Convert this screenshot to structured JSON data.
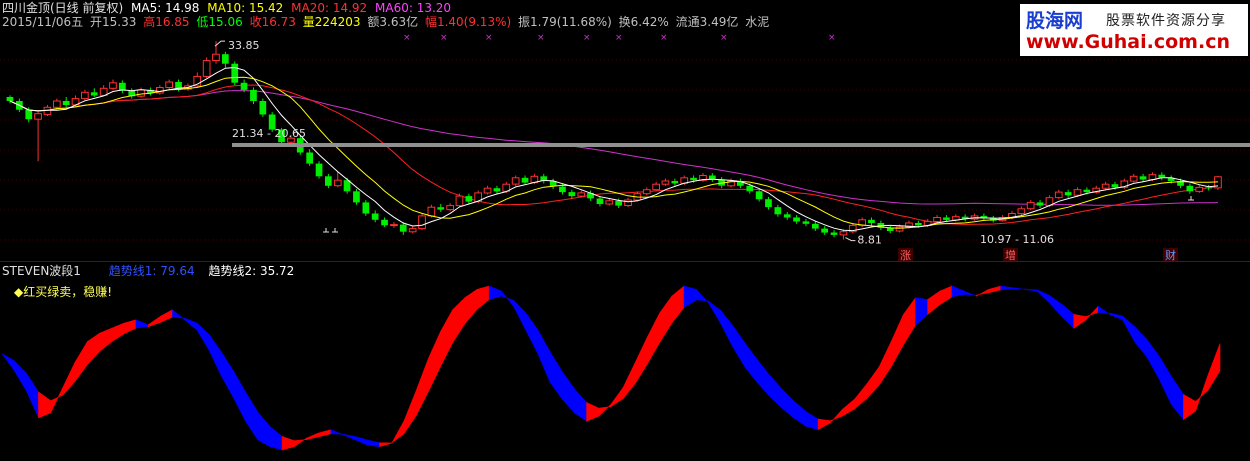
{
  "header": {
    "title": "四川金顶(日线 前复权)",
    "ma5": "MA5: 14.98",
    "ma10": "MA10: 15.42",
    "ma20": "MA20: 14.92",
    "ma60": "MA60: 13.20",
    "date": "2015/11/06五",
    "open": "开15.33",
    "high": "高16.85",
    "low": "低15.06",
    "close": "收16.73",
    "volume": "量224203",
    "amount": "额3.63亿",
    "change": "幅1.40(9.13%)",
    "amplitude": "振1.79(11.68%)",
    "turnover": "换6.42%",
    "float": "流通3.49亿",
    "industry": "水泥"
  },
  "watermark": {
    "brand": "股海网",
    "slogan": "股票软件资源分享",
    "url": "www.Guhai.com.cn"
  },
  "indicator": {
    "name": "STEVEN波段1",
    "line1": "趋势线1: 79.64",
    "line2": "趋势线2: 35.72",
    "note": "◆红买绿卖，稳赚!"
  },
  "colors": {
    "up": "#ff3030",
    "down": "#00ee00",
    "ma5": "#ffffff",
    "ma10": "#ffff00",
    "ma20": "#ff2020",
    "ma60": "#cc33cc",
    "band_up": "#ff0000",
    "band_down": "#0000ff"
  },
  "chart_data": [
    {
      "type": "candlestick",
      "annotations": {
        "high": "33.85",
        "range1": "21.34 - 20.65",
        "low": "8.81",
        "range2": "10.97 - 11.06",
        "events": [
          "涨",
          "增",
          "财"
        ]
      },
      "candles": [
        [
          26.8,
          26.3,
          27.0,
          26.0
        ],
        [
          26.3,
          25.2,
          26.6,
          24.9
        ],
        [
          25.2,
          24.0,
          25.5,
          23.6
        ],
        [
          24.0,
          24.7,
          25.0,
          18.7
        ],
        [
          24.6,
          25.5,
          25.8,
          24.4
        ],
        [
          25.5,
          26.3,
          26.6,
          25.2
        ],
        [
          26.3,
          25.8,
          26.8,
          25.5
        ],
        [
          25.8,
          26.6,
          27.0,
          25.6
        ],
        [
          26.6,
          27.4,
          27.7,
          26.4
        ],
        [
          27.4,
          27.0,
          27.9,
          26.8
        ],
        [
          27.0,
          27.9,
          28.3,
          26.9
        ],
        [
          27.9,
          28.6,
          29.0,
          27.7
        ],
        [
          28.6,
          27.6,
          28.9,
          27.3
        ],
        [
          27.6,
          26.9,
          27.9,
          26.6
        ],
        [
          26.9,
          27.7,
          28.0,
          26.7
        ],
        [
          27.7,
          27.3,
          28.0,
          27.0
        ],
        [
          27.3,
          28.0,
          28.3,
          27.1
        ],
        [
          28.0,
          28.7,
          29.0,
          27.8
        ],
        [
          28.7,
          27.8,
          29.0,
          27.5
        ],
        [
          27.8,
          28.2,
          28.5,
          27.6
        ],
        [
          28.2,
          29.4,
          29.9,
          28.0
        ],
        [
          29.4,
          31.4,
          31.8,
          29.2
        ],
        [
          31.4,
          32.2,
          33.85,
          31.0
        ],
        [
          32.2,
          31.0,
          32.5,
          30.5
        ],
        [
          31.0,
          28.6,
          31.3,
          28.3
        ],
        [
          28.6,
          27.7,
          29.0,
          27.4
        ],
        [
          27.7,
          26.3,
          28.0,
          25.9
        ],
        [
          26.3,
          24.6,
          26.6,
          24.3
        ],
        [
          24.6,
          22.7,
          24.9,
          22.4
        ],
        [
          22.7,
          21.1,
          22.9,
          20.7
        ],
        [
          21.1,
          21.6,
          22.0,
          20.9
        ],
        [
          21.6,
          19.8,
          21.9,
          19.5
        ],
        [
          19.8,
          18.4,
          20.2,
          18.1
        ],
        [
          18.4,
          16.8,
          18.7,
          16.5
        ],
        [
          16.8,
          15.6,
          17.1,
          15.3
        ],
        [
          15.6,
          16.3,
          17.4,
          15.4
        ],
        [
          16.3,
          14.9,
          16.6,
          14.6
        ],
        [
          14.9,
          13.5,
          15.2,
          13.2
        ],
        [
          13.5,
          12.1,
          13.8,
          11.8
        ],
        [
          12.1,
          11.3,
          12.5,
          11.0
        ],
        [
          11.3,
          10.6,
          11.6,
          10.4
        ],
        [
          10.6,
          10.7,
          11.0,
          10.3
        ],
        [
          10.7,
          9.8,
          11.0,
          9.4
        ],
        [
          9.8,
          10.2,
          10.6,
          9.6
        ],
        [
          10.2,
          11.8,
          12.1,
          10.0
        ],
        [
          11.8,
          12.9,
          13.2,
          11.6
        ],
        [
          12.9,
          12.6,
          13.3,
          12.3
        ],
        [
          12.6,
          13.1,
          13.4,
          12.4
        ],
        [
          13.1,
          14.3,
          14.6,
          12.9
        ],
        [
          14.3,
          13.6,
          14.6,
          13.3
        ],
        [
          13.6,
          14.7,
          15.0,
          13.4
        ],
        [
          14.7,
          15.3,
          15.6,
          14.5
        ],
        [
          15.3,
          14.9,
          15.6,
          14.6
        ],
        [
          14.9,
          15.8,
          16.1,
          14.7
        ],
        [
          15.8,
          16.6,
          16.9,
          15.6
        ],
        [
          16.6,
          16.0,
          16.9,
          15.7
        ],
        [
          16.0,
          16.8,
          17.1,
          15.8
        ],
        [
          16.8,
          16.2,
          17.1,
          15.9
        ],
        [
          16.2,
          15.5,
          16.5,
          15.2
        ],
        [
          15.5,
          14.8,
          15.8,
          14.5
        ],
        [
          14.8,
          14.3,
          15.1,
          14.0
        ],
        [
          14.3,
          14.7,
          15.0,
          14.1
        ],
        [
          14.7,
          14.0,
          15.0,
          13.7
        ],
        [
          14.0,
          13.3,
          14.3,
          13.0
        ],
        [
          13.3,
          13.7,
          14.0,
          13.1
        ],
        [
          13.7,
          13.1,
          14.0,
          12.8
        ],
        [
          13.1,
          13.8,
          14.1,
          12.9
        ],
        [
          13.8,
          14.6,
          14.9,
          13.6
        ],
        [
          14.6,
          15.1,
          15.4,
          14.4
        ],
        [
          15.1,
          15.8,
          16.1,
          14.9
        ],
        [
          15.8,
          16.2,
          16.5,
          15.6
        ],
        [
          16.2,
          15.9,
          16.5,
          15.6
        ],
        [
          15.9,
          16.6,
          16.9,
          15.7
        ],
        [
          16.6,
          16.3,
          16.9,
          16.0
        ],
        [
          16.3,
          16.9,
          17.2,
          16.1
        ],
        [
          16.9,
          16.4,
          17.2,
          16.1
        ],
        [
          16.4,
          15.6,
          16.7,
          15.3
        ],
        [
          15.6,
          16.2,
          16.5,
          15.4
        ],
        [
          16.2,
          15.6,
          16.5,
          15.3
        ],
        [
          15.6,
          14.9,
          15.9,
          14.6
        ],
        [
          14.9,
          13.9,
          15.2,
          13.6
        ],
        [
          13.9,
          12.9,
          14.2,
          12.6
        ],
        [
          12.9,
          12.0,
          13.2,
          11.7
        ],
        [
          12.0,
          11.6,
          12.3,
          11.3
        ],
        [
          11.6,
          11.1,
          11.9,
          10.8
        ],
        [
          11.1,
          10.8,
          11.4,
          10.5
        ],
        [
          10.8,
          10.2,
          11.1,
          9.9
        ],
        [
          10.2,
          9.7,
          10.5,
          9.4
        ],
        [
          9.7,
          9.4,
          10.0,
          9.1
        ],
        [
          9.4,
          9.8,
          10.1,
          8.81
        ],
        [
          9.8,
          10.6,
          10.9,
          9.6
        ],
        [
          10.6,
          11.3,
          11.6,
          10.4
        ],
        [
          11.3,
          10.9,
          11.6,
          10.6
        ],
        [
          10.9,
          10.3,
          11.2,
          10.0
        ],
        [
          10.3,
          9.9,
          10.6,
          9.6
        ],
        [
          9.9,
          10.4,
          10.7,
          9.7
        ],
        [
          10.4,
          10.9,
          11.2,
          10.2
        ],
        [
          10.9,
          10.6,
          11.2,
          10.3
        ],
        [
          10.6,
          11.1,
          11.4,
          10.4
        ],
        [
          11.1,
          11.6,
          11.9,
          10.9
        ],
        [
          11.6,
          11.3,
          11.9,
          11.0
        ],
        [
          11.3,
          11.7,
          12.0,
          11.1
        ],
        [
          11.7,
          11.4,
          12.0,
          11.1
        ],
        [
          11.4,
          11.8,
          12.1,
          11.2
        ],
        [
          11.8,
          11.5,
          12.1,
          11.2
        ],
        [
          11.5,
          11.2,
          11.8,
          10.97
        ],
        [
          11.2,
          11.6,
          11.9,
          11.06
        ],
        [
          11.6,
          12.1,
          12.4,
          11.4
        ],
        [
          12.1,
          12.7,
          13.0,
          11.9
        ],
        [
          12.7,
          13.5,
          13.8,
          12.5
        ],
        [
          13.5,
          13.1,
          13.8,
          12.8
        ],
        [
          13.1,
          14.1,
          14.4,
          12.9
        ],
        [
          14.1,
          14.8,
          15.1,
          13.9
        ],
        [
          14.8,
          14.4,
          15.1,
          14.1
        ],
        [
          14.4,
          15.1,
          15.4,
          14.2
        ],
        [
          15.1,
          14.8,
          15.4,
          14.5
        ],
        [
          14.8,
          15.3,
          15.6,
          14.6
        ],
        [
          15.3,
          15.8,
          16.1,
          15.1
        ],
        [
          15.8,
          15.4,
          16.1,
          15.1
        ],
        [
          15.4,
          16.2,
          16.5,
          15.2
        ],
        [
          16.2,
          16.8,
          17.1,
          16.0
        ],
        [
          16.8,
          16.4,
          17.1,
          16.1
        ],
        [
          16.4,
          17.0,
          17.3,
          16.2
        ],
        [
          17.0,
          16.6,
          17.3,
          16.3
        ],
        [
          16.6,
          16.2,
          16.9,
          15.9
        ],
        [
          16.2,
          15.6,
          16.5,
          15.3
        ],
        [
          15.6,
          14.9,
          15.9,
          14.6
        ],
        [
          14.9,
          15.4,
          15.7,
          14.7
        ],
        [
          15.4,
          15.3,
          15.7,
          15.0
        ],
        [
          15.33,
          16.73,
          16.85,
          15.06
        ]
      ]
    },
    {
      "type": "area",
      "ylim": [
        0,
        100
      ],
      "values": [
        60,
        50,
        38,
        22,
        25,
        40,
        55,
        67,
        72,
        75,
        78,
        80,
        77,
        82,
        86,
        80,
        74,
        62,
        47,
        34,
        20,
        9,
        5,
        3,
        5,
        10,
        13,
        15,
        12,
        9,
        6,
        5,
        7,
        20,
        38,
        57,
        73,
        86,
        93,
        98,
        100,
        97,
        88,
        74,
        60,
        43,
        33,
        25,
        20,
        23,
        30,
        40,
        55,
        70,
        84,
        94,
        100,
        98,
        90,
        78,
        64,
        52,
        43,
        35,
        28,
        22,
        17,
        15,
        19,
        27,
        33,
        42,
        52,
        67,
        83,
        93,
        92,
        97,
        100,
        97,
        94,
        98,
        100,
        99,
        98,
        97,
        90,
        82,
        75,
        80,
        88,
        83,
        80,
        67,
        58,
        45,
        30,
        21,
        26,
        47,
        66
      ]
    }
  ]
}
